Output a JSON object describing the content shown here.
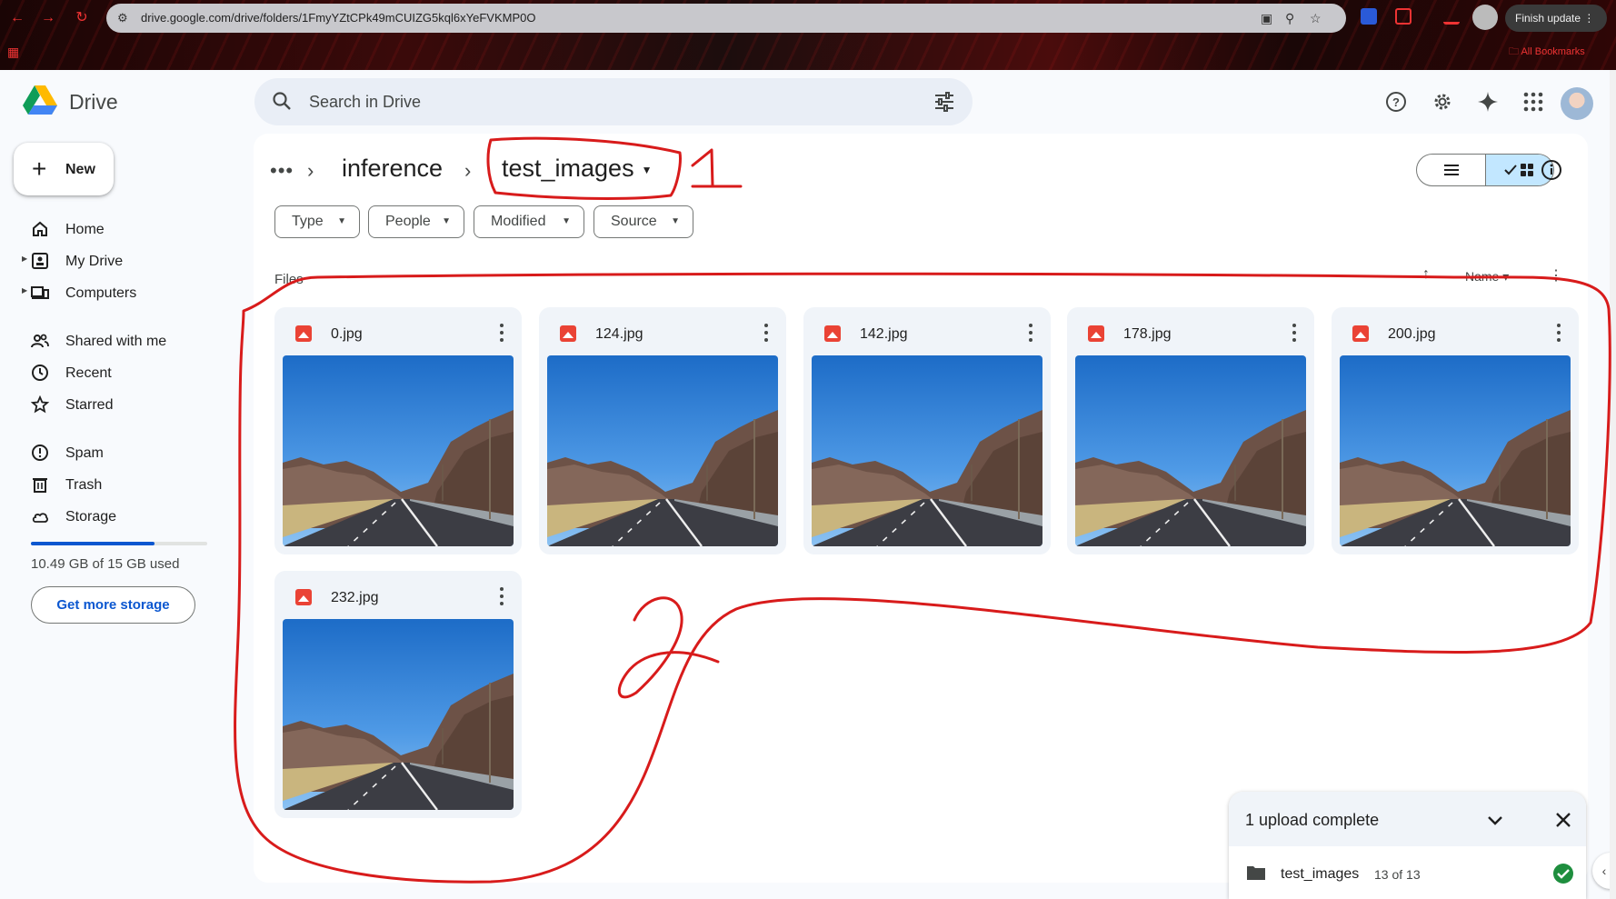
{
  "browser": {
    "url": "drive.google.com/drive/folders/1FmyYZtCPk49mCUIZG5kql6xYeFVKMP0O",
    "update_label": "Finish update",
    "bookmarks_label": "All Bookmarks"
  },
  "header": {
    "brand": "Drive",
    "search_placeholder": "Search in Drive"
  },
  "sidebar": {
    "new_label": "New",
    "items": [
      {
        "label": "Home",
        "icon": "home-icon"
      },
      {
        "label": "My Drive",
        "icon": "my-drive-icon"
      },
      {
        "label": "Computers",
        "icon": "computers-icon"
      },
      {
        "label": "Shared with me",
        "icon": "shared-icon"
      },
      {
        "label": "Recent",
        "icon": "clock-icon"
      },
      {
        "label": "Starred",
        "icon": "star-icon"
      },
      {
        "label": "Spam",
        "icon": "spam-icon"
      },
      {
        "label": "Trash",
        "icon": "trash-icon"
      },
      {
        "label": "Storage",
        "icon": "cloud-icon"
      }
    ],
    "storage_text": "10.49 GB of 15 GB used",
    "storage_fraction": 0.7,
    "get_storage_label": "Get more storage"
  },
  "breadcrumb": {
    "parent": "inference",
    "current": "test_images"
  },
  "filters": [
    "Type",
    "People",
    "Modified",
    "Source"
  ],
  "files_section": {
    "label": "Files",
    "sort_label": "Name",
    "files": [
      "0.jpg",
      "124.jpg",
      "142.jpg",
      "178.jpg",
      "200.jpg",
      "232.jpg"
    ]
  },
  "upload": {
    "title": "1 upload complete",
    "item_name": "test_images",
    "item_count": "13 of 13"
  },
  "annotations": {
    "label_1": "1",
    "label_2": "2",
    "color": "#d81b1b"
  },
  "colors": {
    "accent": "#0b57d0",
    "selected": "#c2e7ff",
    "file_icon": "#ea4335",
    "success": "#1e8e3e"
  }
}
